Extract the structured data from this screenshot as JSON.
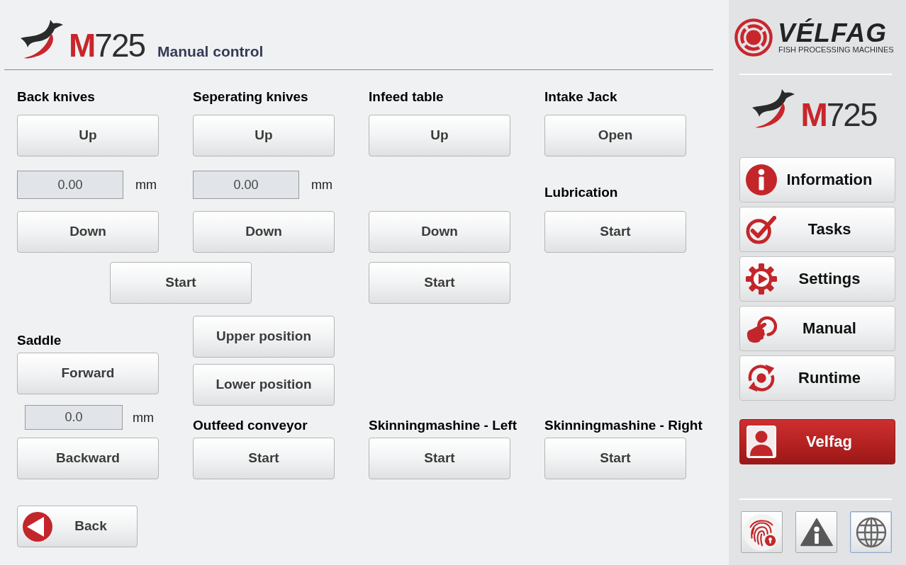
{
  "header": {
    "logo": "**M**725",
    "title": "Manual control"
  },
  "back_knives": {
    "label": "Back knives",
    "up_button": "Up",
    "position": {
      "value": "0.00",
      "unit": "mm"
    },
    "down_button": "Down"
  },
  "separating_knives": {
    "label": "Seperating knives",
    "up_button": "Up",
    "position": {
      "value": "0.00",
      "unit": "mm"
    },
    "down_button": "Down"
  },
  "knives_start_button": "Start",
  "infeed_table": {
    "label": "Infeed table",
    "up_button": "Up",
    "down_button": "Down",
    "start_button": "Start"
  },
  "intake_jack": {
    "label": "Intake Jack",
    "button": "Open"
  },
  "lubrication": {
    "label": "Lubrication",
    "button": "Start"
  },
  "saddle": {
    "label": "Saddle",
    "forward_button": "Forward",
    "position": {
      "value": "0.0",
      "unit": "mm"
    },
    "backward_button": "Backward"
  },
  "saddle_position_buttons": [
    "Upper position",
    "Lower position"
  ],
  "outfeed_conveyor": {
    "label": "Outfeed conveyor",
    "button": "Start"
  },
  "skinning_machine_left": {
    "label": "Skinningmashine - Left",
    "button": "Start"
  },
  "skinning_machine_right": {
    "label": "Skinningmashine - Right",
    "button": "Start"
  },
  "back_button": "Back",
  "sidebar": {
    "brand": {
      "name": "VÉLFAG",
      "tagline": "FISH PROCESSING MACHINES"
    },
    "logo": "**M**725",
    "menu": [
      {
        "label": "Information",
        "kind": "nav"
      },
      {
        "label": "Tasks",
        "kind": "nav"
      },
      {
        "label": "Settings",
        "kind": "nav"
      },
      {
        "label": "Manual",
        "kind": "nav"
      },
      {
        "label": "Runtime",
        "kind": "nav"
      },
      {
        "label": "Velfag",
        "kind": "user"
      }
    ],
    "tool_buttons": [
      {
        "selected": false
      },
      {
        "selected": false
      },
      {
        "selected": true
      }
    ]
  }
}
